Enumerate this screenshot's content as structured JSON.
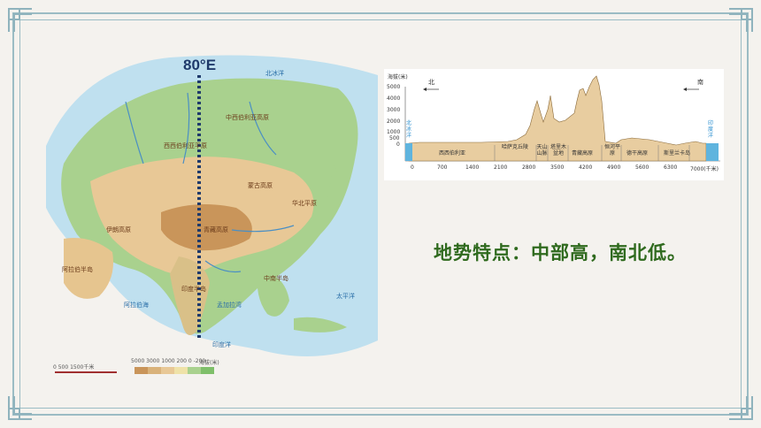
{
  "meridian_label": "80°E",
  "headline": "地势特点：中部高，南北低。",
  "profile": {
    "y_title": "海拔(米)",
    "y_ticks": [
      "5000",
      "4000",
      "3000",
      "2000",
      "1000",
      "500",
      "0"
    ],
    "x_ticks": [
      "0",
      "700",
      "1400",
      "2100",
      "2800",
      "3500",
      "4200",
      "4900",
      "5600",
      "6300",
      "7000(千米)"
    ],
    "north_label": "北",
    "south_label": "南",
    "left_ocean": "北冰洋",
    "right_ocean": "印度洋",
    "regions": [
      "西西伯利亚",
      "哈萨克丘陵",
      "天山山脉",
      "塔里木盆地",
      "青藏高原",
      "恒河平原",
      "德干高原",
      "斯里兰卡岛"
    ]
  },
  "map": {
    "legend_values": "5000 3000 1000 200 0 -200",
    "scale_label": "0  500  1500千米",
    "legend_title": "海拔(米)",
    "labels": [
      "西西伯利亚平原",
      "中西伯利亚高原",
      "伊朗高原",
      "阿拉伯半岛",
      "印度半岛",
      "青藏高原",
      "蒙古高原",
      "华北平原",
      "中南半岛",
      "印度洋",
      "太平洋",
      "北冰洋",
      "阿拉伯海",
      "孟加拉湾"
    ]
  },
  "colors": {
    "frame": "#9bbcc4",
    "headline": "#2f6a1e",
    "meridian": "#1f3a6b",
    "sea": "#bfe0ef",
    "lowland": "#a9d18e",
    "highland": "#e8c896"
  }
}
